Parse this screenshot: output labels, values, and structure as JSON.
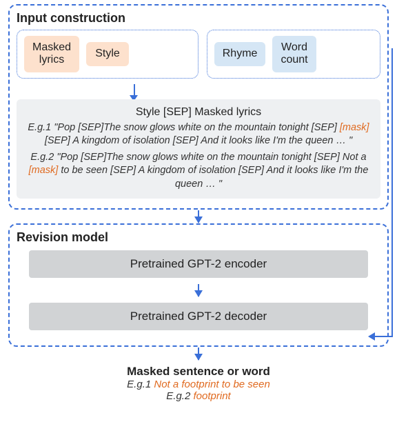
{
  "input_construction": {
    "title": "Input construction",
    "pills": {
      "masked_lyrics": "Masked\nlyrics",
      "style": "Style",
      "rhyme": "Rhyme",
      "word_count": "Word\ncount"
    },
    "example_header": "Style [SEP] Masked lyrics",
    "eg1_label": "E.g.1",
    "eg1_pre": "\"Pop [SEP]The snow glows white on the mountain tonight [SEP] ",
    "eg1_mask": "[mask]",
    "eg1_post": " [SEP] A kingdom of isolation [SEP] And it looks like I'm the queen … \"",
    "eg2_label": "E.g.2",
    "eg2_pre": "\"Pop [SEP]The snow glows white on the mountain tonight [SEP] Not a ",
    "eg2_mask": "[mask]",
    "eg2_post": " to be seen [SEP] A kingdom of isolation [SEP] And it looks like I'm the queen … \""
  },
  "revision_model": {
    "title": "Revision model",
    "encoder": "Pretrained GPT-2 encoder",
    "decoder": "Pretrained GPT-2 decoder"
  },
  "output": {
    "title": "Masked sentence or word",
    "eg1_label": "E.g.1",
    "eg1_text": "Not a footprint to be seen",
    "eg2_label": "E.g.2",
    "eg2_text": "footprint"
  }
}
